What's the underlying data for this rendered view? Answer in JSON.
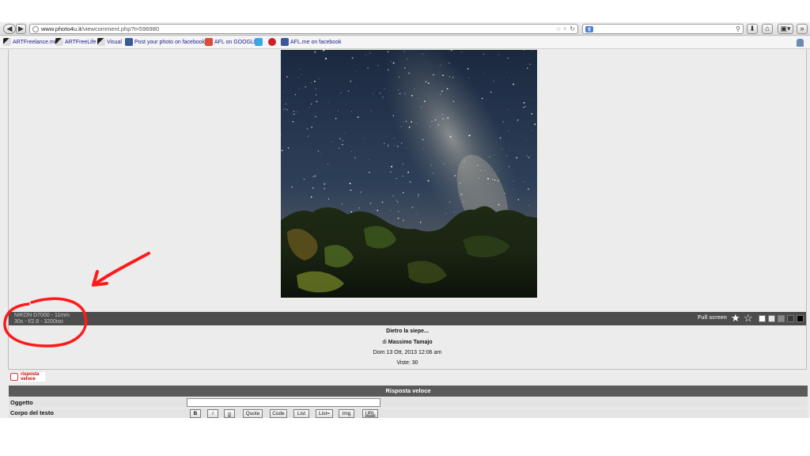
{
  "browser": {
    "url_host": "www.photo4u.it",
    "url_path": "/viewcomment.php?t=596980",
    "back_icon": "back-arrow-icon",
    "forward_icon": "forward-arrow-icon"
  },
  "bookmarks": [
    {
      "label": "ARTFreelance.me",
      "icon": "afl-icon"
    },
    {
      "label": "ARTFreeLife",
      "icon": "afl-icon"
    },
    {
      "label": "Visual",
      "icon": "afl-icon"
    },
    {
      "label": "Post your photo on facebook",
      "icon": "facebook-icon"
    },
    {
      "label": "AFL on GOOGLE",
      "icon": "google-plus-icon"
    },
    {
      "label": "",
      "icon": "twitter-icon"
    },
    {
      "label": "",
      "icon": "pinterest-icon"
    },
    {
      "label": "AFL.me on facebook",
      "icon": "facebook-icon"
    }
  ],
  "photo": {
    "exif_camera": "NIKON D7000 - 11mm",
    "exif_settings": "30s - f/2.8 - 3200iso",
    "fullscreen_label": "Full screen",
    "star_filled": "★",
    "star_empty": "☆",
    "swatches": [
      "#ffffff",
      "#e6e6e6",
      "#8a8a8a",
      "#3a3a3a",
      "#000000"
    ]
  },
  "caption": {
    "title": "Dietro la siepe...",
    "author_prefix": "di",
    "author": "Massimo Tamajo",
    "date": "Dom 13 Ott, 2013 12:06 am",
    "views": "Viste: 30"
  },
  "quick_reply_logo": {
    "line1": "risposta",
    "line2": "veloce"
  },
  "reply_form": {
    "header": "Risposta veloce",
    "subject_label": "Oggetto",
    "subject_value": "",
    "body_label": "Corpo del testo",
    "buttons": [
      "B",
      "i",
      "u",
      "Quote",
      "Code",
      "List",
      "List=",
      "Img",
      "URL"
    ]
  }
}
